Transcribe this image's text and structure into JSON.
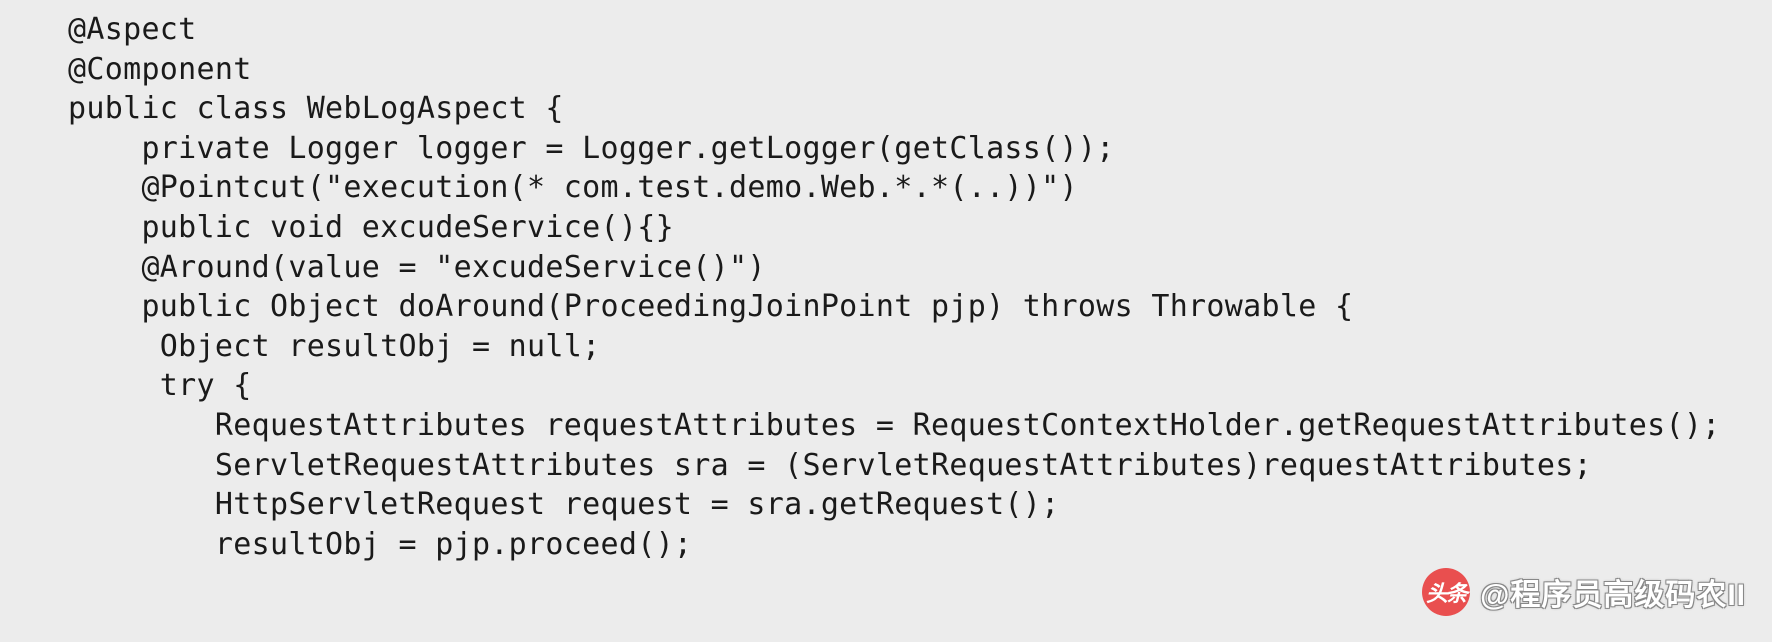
{
  "code": {
    "lines": [
      "@Aspect",
      "@Component",
      "public class WebLogAspect {",
      "    private Logger logger = Logger.getLogger(getClass());",
      "    @Pointcut(\"execution(* com.test.demo.Web.*.*(..))\")",
      "    public void excudeService(){}",
      "    @Around(value = \"excudeService()\")",
      "    public Object doAround(ProceedingJoinPoint pjp) throws Throwable {",
      "     Object resultObj = null;",
      "     try {",
      "        RequestAttributes requestAttributes = RequestContextHolder.getRequestAttributes();",
      "        ServletRequestAttributes sra = (ServletRequestAttributes)requestAttributes;",
      "        HttpServletRequest request = sra.getRequest();",
      "        resultObj = pjp.proceed();"
    ]
  },
  "watermark": {
    "logo_text": "头条",
    "text": "@程序员高级码农II"
  }
}
